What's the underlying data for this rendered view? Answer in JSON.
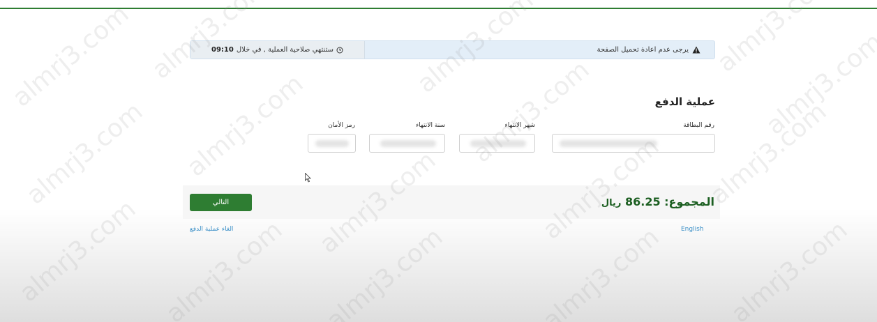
{
  "banner": {
    "warning_text": "يرجى عدم اعادة تحميل الصفحة",
    "timer_text": "ستنتهي صلاحية العملية , في خلال",
    "timer_value": "09:10"
  },
  "form": {
    "title": "عملية الدفع",
    "card_number_label": "رقم البطاقة",
    "expiry_month_label": "شهر الانتهاء",
    "expiry_year_label": "سنة الانتهاء",
    "security_code_label": "رمز الأمان"
  },
  "total": {
    "label": "المجموع:",
    "amount": "86.25",
    "currency": "ريال"
  },
  "actions": {
    "next_label": "التالي",
    "cancel_label": "الغاء عملية الدفع",
    "language_label": "English"
  },
  "watermark": {
    "text": "almrj3.com"
  },
  "colors": {
    "primary": "#2e7d32",
    "banner_bg": "#e3eef8",
    "link": "#3a8fc7"
  },
  "icons": {
    "warning": "warning-triangle-icon",
    "clock": "clock-icon",
    "cursor": "mouse-cursor-icon"
  }
}
